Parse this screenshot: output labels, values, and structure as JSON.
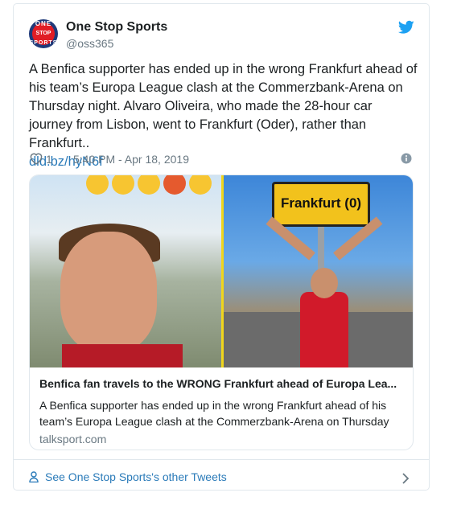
{
  "author": {
    "display_name": "One Stop Sports",
    "handle": "@oss365",
    "avatar_text_top": "ONE",
    "avatar_text_mid": "STOP",
    "avatar_text_bottom": "SPORTS"
  },
  "tweet": {
    "text": "A Benfica supporter has ended up in the wrong Frankfurt ahead of his team’s Europa League clash at the Commerzbank-Arena on Thursday night. Alvaro Oliveira, who made the 28-hour car journey from Lisbon, went to Frankfurt (Oder), rather than Frankfurt..",
    "link": "dld.bz/hyN6f"
  },
  "meta": {
    "likes": "1",
    "timestamp": "5:40 PM - Apr 18, 2019"
  },
  "card": {
    "sign_text": "Frankfurt (0)",
    "title": "Benfica fan travels to the WRONG Frankfurt ahead of Europa Lea...",
    "description": "A Benfica supporter has ended up in the wrong Frankfurt ahead of his team’s Europa League clash at the Commerzbank-Arena on Thursday",
    "domain": "talksport.com"
  },
  "footer": {
    "link_label": "See One Stop Sports's other Tweets"
  },
  "colors": {
    "link": "#2b7bb9",
    "twitter_blue": "#1da1f2",
    "muted": "#697882",
    "border": "#e1e8ed"
  },
  "icons": [
    "twitter-bird-icon",
    "heart-icon",
    "info-icon",
    "person-icon",
    "chevron-right-icon"
  ]
}
